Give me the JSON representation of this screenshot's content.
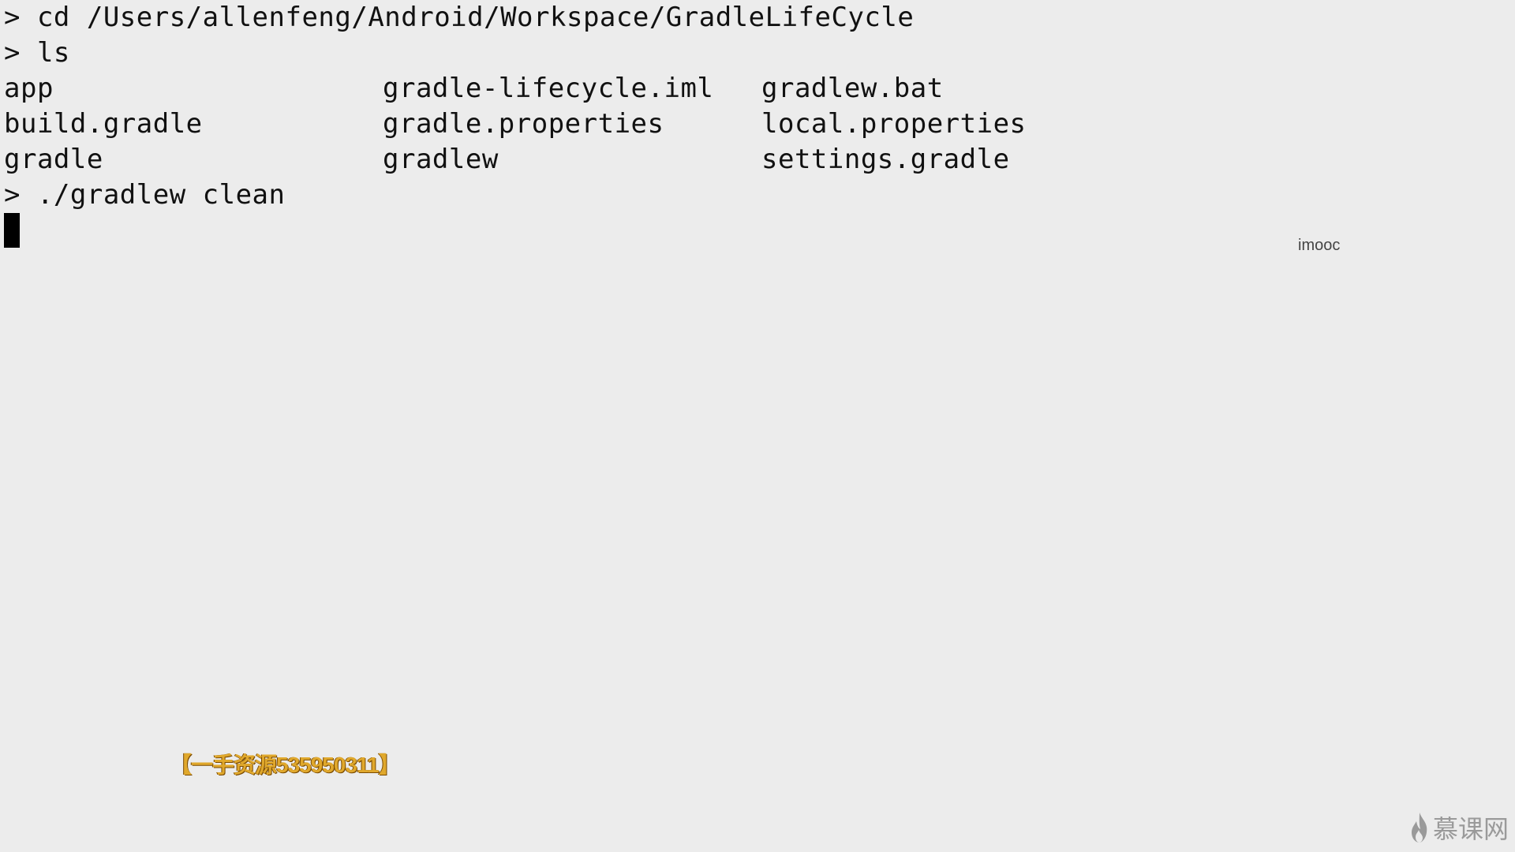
{
  "terminal": {
    "prompt": ">",
    "command_cd": "> cd /Users/allenfeng/Android/Workspace/GradleLifeCycle",
    "command_ls": "> ls",
    "ls_output": [
      [
        "app",
        "gradle-lifecycle.iml",
        "gradlew.bat"
      ],
      [
        "build.gradle",
        "gradle.properties",
        "local.properties"
      ],
      [
        "gradle",
        "gradlew",
        "settings.gradle"
      ]
    ],
    "command_clean": "> ./gradlew clean"
  },
  "overlay": {
    "imooc_label": "imooc",
    "resource_watermark": "【一手资源535950311】",
    "brand_logo_text": "慕课网",
    "brand_logo_icon": "flame-icon"
  },
  "colors": {
    "background": "#ececec",
    "text": "#111111",
    "cursor": "#000000",
    "watermark": "#e0a82c",
    "logo": "#9a9a9a"
  }
}
